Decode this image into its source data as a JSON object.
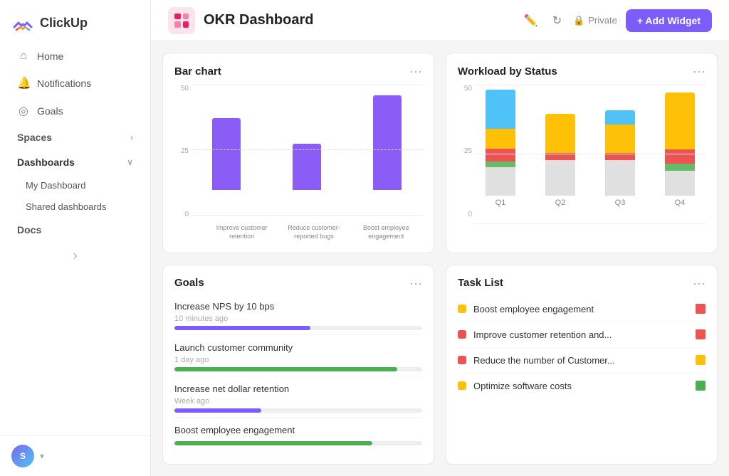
{
  "sidebar": {
    "logo_text": "ClickUp",
    "nav_items": [
      {
        "id": "home",
        "label": "Home",
        "icon": "🏠"
      },
      {
        "id": "notifications",
        "label": "Notifications",
        "icon": "🔔"
      },
      {
        "id": "goals",
        "label": "Goals",
        "icon": "🏆"
      }
    ],
    "spaces_label": "Spaces",
    "dashboards_label": "Dashboards",
    "my_dashboard_label": "My Dashboard",
    "shared_dashboards_label": "Shared dashboards",
    "docs_label": "Docs",
    "user_initial": "S"
  },
  "topbar": {
    "title": "OKR Dashboard",
    "private_label": "Private",
    "add_widget_label": "+ Add Widget"
  },
  "bar_chart": {
    "title": "Bar chart",
    "y_max": "50",
    "y_mid": "25",
    "y_min": "0",
    "bars": [
      {
        "label": "Improve customer retention",
        "height_pct": 68
      },
      {
        "label": "Reduce customer-reported bugs",
        "height_pct": 44
      },
      {
        "label": "Boost employee engagement",
        "height_pct": 90
      }
    ]
  },
  "workload_chart": {
    "title": "Workload by Status",
    "y_max": "50",
    "y_mid": "25",
    "y_min": "0",
    "quarters": [
      {
        "label": "Q1",
        "segments": [
          {
            "color": "#4fc3f7",
            "height": 55
          },
          {
            "color": "#ffc107",
            "height": 28
          },
          {
            "color": "#ef5350",
            "height": 18
          },
          {
            "color": "#66bb6a",
            "height": 8
          },
          {
            "color": "#e0e0e0",
            "height": 40
          }
        ],
        "total": 149
      },
      {
        "label": "Q2",
        "segments": [
          {
            "color": "#ffc107",
            "height": 55
          },
          {
            "color": "#ef5350",
            "height": 10
          },
          {
            "color": "#e0e0e0",
            "height": 50
          }
        ],
        "total": 115
      },
      {
        "label": "Q3",
        "segments": [
          {
            "color": "#4fc3f7",
            "height": 20
          },
          {
            "color": "#ffc107",
            "height": 40
          },
          {
            "color": "#ef5350",
            "height": 10
          },
          {
            "color": "#e0e0e0",
            "height": 50
          }
        ],
        "total": 120
      },
      {
        "label": "Q4",
        "segments": [
          {
            "color": "#ffc107",
            "height": 80
          },
          {
            "color": "#ef5350",
            "height": 20
          },
          {
            "color": "#66bb6a",
            "height": 10
          },
          {
            "color": "#e0e0e0",
            "height": 35
          }
        ],
        "total": 145
      }
    ]
  },
  "goals_widget": {
    "title": "Goals",
    "items": [
      {
        "name": "Increase NPS by 10 bps",
        "time": "10 minutes ago",
        "progress": 55,
        "color": "#7c5cfc"
      },
      {
        "name": "Launch customer community",
        "time": "1 day ago",
        "progress": 90,
        "color": "#4caf50"
      },
      {
        "name": "Increase net dollar retention",
        "time": "Week ago",
        "progress": 35,
        "color": "#7c5cfc"
      },
      {
        "name": "Boost employee engagement",
        "time": "",
        "progress": 80,
        "color": "#4caf50"
      }
    ]
  },
  "task_list_widget": {
    "title": "Task List",
    "items": [
      {
        "name": "Boost employee engagement",
        "dot_color": "#ffc107",
        "flag_color": "#ef5350"
      },
      {
        "name": "Improve customer retention and...",
        "dot_color": "#ef5350",
        "flag_color": "#ef5350"
      },
      {
        "name": "Reduce the number of Customer...",
        "dot_color": "#ef5350",
        "flag_color": "#ffc107"
      },
      {
        "name": "Optimize software costs",
        "dot_color": "#ffc107",
        "flag_color": "#4caf50"
      }
    ]
  }
}
